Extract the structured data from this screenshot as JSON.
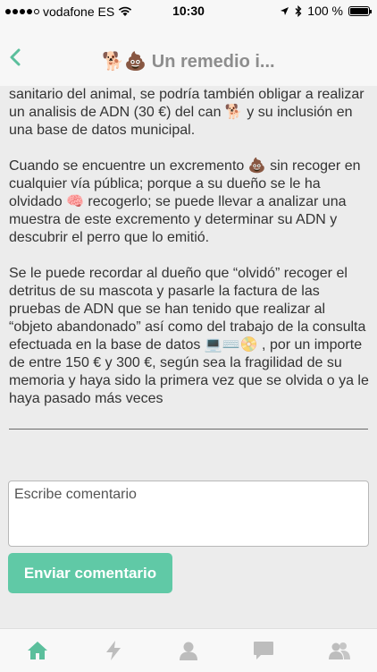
{
  "status": {
    "carrier": "vodafone ES",
    "time": "10:30",
    "battery_text": "100 %",
    "battery_level": 1.0
  },
  "nav": {
    "title": "🐕💩 Un remedio i...",
    "back_icon": "chevron-left-icon"
  },
  "article": {
    "paragraphs": [
      "sanitario del animal, se podría también obligar a realizar un  analisis de ADN (30 €) del can 🐕 y su inclusión en una base de datos municipal.",
      "Cuando se encuentre un excremento 💩 sin recoger en cualquier vía pública; porque a su dueño se le ha olvidado 🧠 recogerlo; se puede llevar a analizar una muestra de este excremento y determinar su ADN y descubrir el perro que lo emitió.",
      "Se le puede recordar al dueño que “olvidó” recoger el detritus de su mascota y pasarle la factura de las pruebas de ADN que se han tenido que realizar al “objeto abandonado” así como del trabajo de la consulta efectuada en la base de datos 💻⌨️📀 , por un importe de entre 150 € y 300 €, según sea la fragilidad de su memoria y haya sido la primera vez que se olvida o ya le haya pasado más veces"
    ]
  },
  "comment": {
    "placeholder": "Escribe comentario",
    "value": ""
  },
  "send_button": {
    "label": "Enviar comentario"
  },
  "colors": {
    "accent": "#60c9a6",
    "active_tab": "#5bbf9c",
    "inactive_tab": "#bdbdbd"
  },
  "tabs": [
    {
      "icon": "home-icon",
      "active": true
    },
    {
      "icon": "lightning-icon",
      "active": false
    },
    {
      "icon": "user-icon",
      "active": false
    },
    {
      "icon": "chat-bubble-icon",
      "active": false
    },
    {
      "icon": "group-icon",
      "active": false
    }
  ]
}
